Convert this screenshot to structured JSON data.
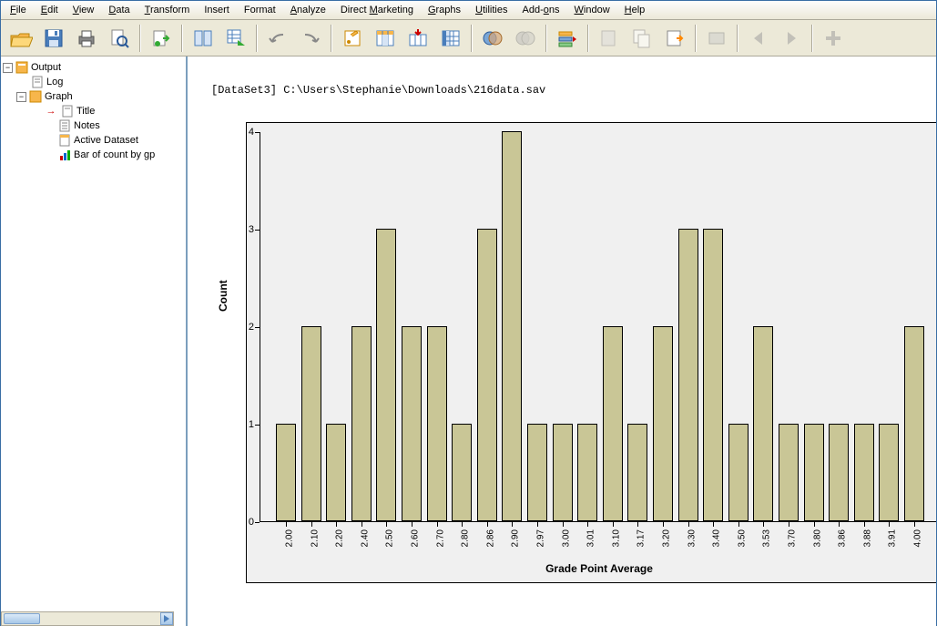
{
  "menu": {
    "file": "File",
    "edit": "Edit",
    "view": "View",
    "data": "Data",
    "transform": "Transform",
    "insert": "Insert",
    "format": "Format",
    "analyze": "Analyze",
    "direct_marketing": "Direct Marketing",
    "graphs": "Graphs",
    "utilities": "Utilities",
    "addons": "Add-ons",
    "window": "Window",
    "help": "Help"
  },
  "tree": {
    "output": "Output",
    "log": "Log",
    "graph": "Graph",
    "title": "Title",
    "notes": "Notes",
    "active_dataset": "Active Dataset",
    "bar_of_count": "Bar of count by gp"
  },
  "content": {
    "dataset_path": "[DataSet3] C:\\Users\\Stephanie\\Downloads\\216data.sav"
  },
  "chart_data": {
    "type": "bar",
    "ylabel": "Count",
    "xlabel": "Grade Point Average",
    "ylim": [
      0,
      4
    ],
    "yticks": [
      0,
      1,
      2,
      3,
      4
    ],
    "categories": [
      "2.00",
      "2.10",
      "2.20",
      "2.40",
      "2.50",
      "2.60",
      "2.70",
      "2.80",
      "2.86",
      "2.90",
      "2.97",
      "3.00",
      "3.01",
      "3.10",
      "3.17",
      "3.20",
      "3.30",
      "3.40",
      "3.50",
      "3.53",
      "3.70",
      "3.80",
      "3.86",
      "3.88",
      "3.91",
      "4.00"
    ],
    "values": [
      1,
      2,
      1,
      2,
      3,
      2,
      2,
      1,
      3,
      4,
      1,
      1,
      1,
      2,
      1,
      2,
      3,
      3,
      1,
      2,
      1,
      1,
      1,
      1,
      1,
      2
    ]
  }
}
